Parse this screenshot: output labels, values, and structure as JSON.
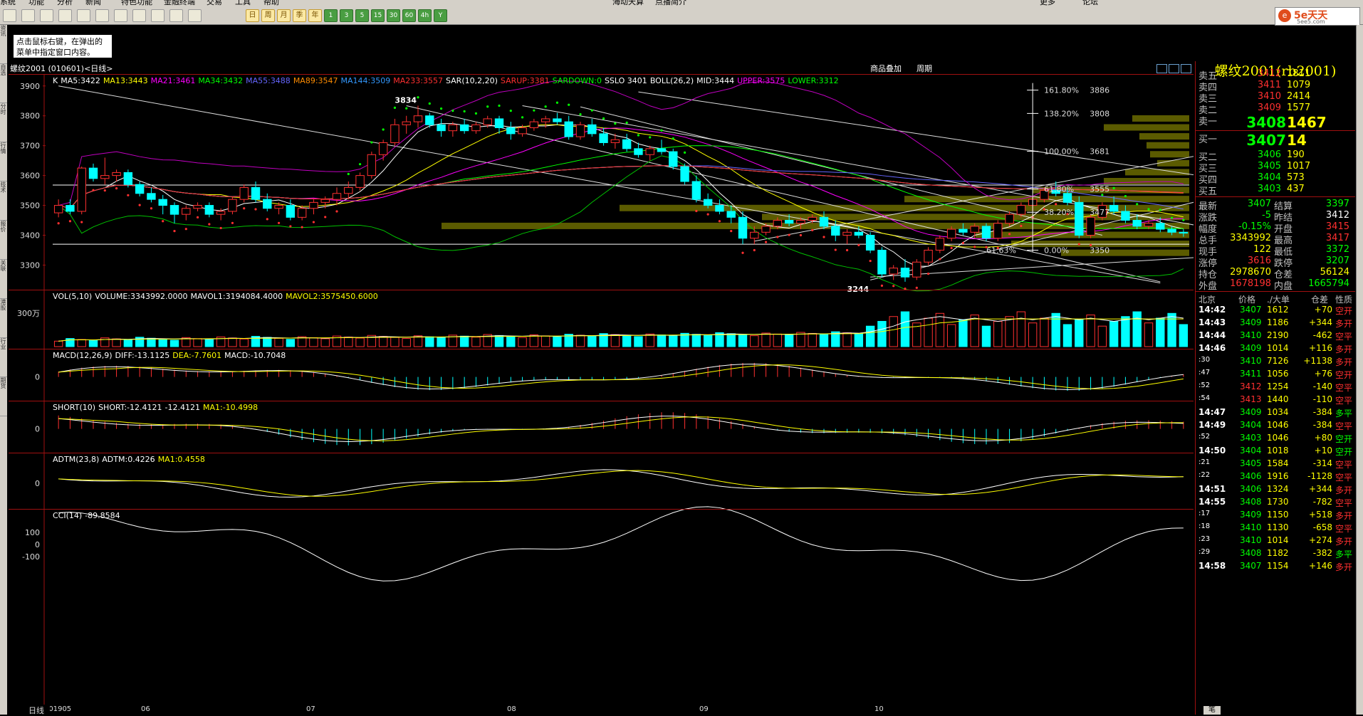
{
  "menu": [
    "系统",
    "功能",
    "分析",
    "新闻",
    "特色功能",
    "金融终端",
    "交易",
    "工具",
    "帮助",
    "海动天算",
    "点播简介",
    "更多",
    "论坛"
  ],
  "toolbar": {
    "periods": [
      "日",
      "周",
      "月",
      "季",
      "年",
      "1",
      "3",
      "5",
      "15",
      "30",
      "60",
      "4h",
      "Y"
    ]
  },
  "logo": {
    "text": "5e天天",
    "sub": "5ee5.com"
  },
  "tooltip": {
    "line1": "点击鼠标右键，在弹出的",
    "line2": "菜单中指定窗口内容。"
  },
  "chart_header": {
    "title": "螺纹2001 (010601)<日线>",
    "link1": "商品叠加",
    "link2": "周期"
  },
  "sidebar_tabs": [
    "资讯",
    "自选",
    "分时",
    "行情",
    "技术",
    "报价",
    "关联",
    "港股",
    "行业",
    "期货"
  ],
  "chart_data": [
    {
      "name": "main",
      "type": "candlestick",
      "labels": [
        {
          "t": "K",
          "c": "#ffffff"
        },
        {
          "t": "MA5:3422",
          "c": "#ffffff"
        },
        {
          "t": "MA13:3443",
          "c": "#ffff00"
        },
        {
          "t": "MA21:3461",
          "c": "#ff00ff"
        },
        {
          "t": "MA34:3432",
          "c": "#00ff00"
        },
        {
          "t": "MA55:3488",
          "c": "#6666ff"
        },
        {
          "t": "MA89:3547",
          "c": "#ff8c00"
        },
        {
          "t": "MA144:3509",
          "c": "#3399ff"
        },
        {
          "t": "MA233:3557",
          "c": "#ff3030"
        },
        {
          "t": "SAR(10,2,20)",
          "c": "#ffffff"
        },
        {
          "t": "SARUP:3381",
          "c": "#ff3030"
        },
        {
          "t": "SARDOWN:0",
          "c": "#00ff00"
        },
        {
          "t": "SSLO 3401",
          "c": "#ffffff"
        },
        {
          "t": "BOLL(26,2)",
          "c": "#ffffff"
        },
        {
          "t": "MID:3444",
          "c": "#ffffff"
        },
        {
          "t": "UPPER:3575",
          "c": "#ff00ff"
        },
        {
          "t": "LOWER:3312",
          "c": "#00ff00"
        }
      ],
      "yticks": [
        3900,
        3800,
        3700,
        3600,
        3500,
        3400,
        3300
      ],
      "ylim": [
        3220,
        3940
      ],
      "fib": [
        {
          "pct": "161.80%",
          "val": "3886",
          "price": 3886
        },
        {
          "pct": "138.20%",
          "val": "3808",
          "price": 3808
        },
        {
          "pct": "100.00%",
          "val": "3681",
          "price": 3681
        },
        {
          "pct": "61.80%",
          "val": "3555",
          "price": 3555
        },
        {
          "pct": "38.20%",
          "val": "3477",
          "price": 3477
        },
        {
          "pct": "0.00%",
          "val": "3350",
          "price": 3350
        }
      ],
      "fib_extra": "61.63%",
      "annotations": [
        {
          "text": "3834",
          "price": 3834
        },
        {
          "text": "3244",
          "price": 3244
        }
      ],
      "candles": [
        [
          3475,
          3520,
          3460,
          3500
        ],
        [
          3500,
          3520,
          3470,
          3480
        ],
        [
          3480,
          3630,
          3470,
          3625
        ],
        [
          3625,
          3640,
          3580,
          3590
        ],
        [
          3590,
          3660,
          3570,
          3600
        ],
        [
          3600,
          3620,
          3580,
          3610
        ],
        [
          3610,
          3620,
          3560,
          3570
        ],
        [
          3570,
          3580,
          3530,
          3540
        ],
        [
          3540,
          3560,
          3510,
          3520
        ],
        [
          3520,
          3535,
          3470,
          3500
        ],
        [
          3500,
          3510,
          3440,
          3470
        ],
        [
          3470,
          3500,
          3450,
          3490
        ],
        [
          3490,
          3510,
          3480,
          3500
        ],
        [
          3500,
          3510,
          3460,
          3470
        ],
        [
          3470,
          3490,
          3450,
          3480
        ],
        [
          3480,
          3530,
          3470,
          3520
        ],
        [
          3520,
          3570,
          3510,
          3560
        ],
        [
          3560,
          3580,
          3510,
          3520
        ],
        [
          3520,
          3540,
          3480,
          3490
        ],
        [
          3490,
          3510,
          3470,
          3500
        ],
        [
          3500,
          3520,
          3450,
          3460
        ],
        [
          3460,
          3500,
          3450,
          3490
        ],
        [
          3490,
          3520,
          3470,
          3510
        ],
        [
          3510,
          3530,
          3490,
          3520
        ],
        [
          3520,
          3560,
          3500,
          3540
        ],
        [
          3540,
          3580,
          3520,
          3560
        ],
        [
          3560,
          3610,
          3550,
          3600
        ],
        [
          3600,
          3680,
          3590,
          3670
        ],
        [
          3670,
          3720,
          3650,
          3710
        ],
        [
          3710,
          3790,
          3700,
          3770
        ],
        [
          3770,
          3800,
          3740,
          3780
        ],
        [
          3780,
          3834,
          3760,
          3800
        ],
        [
          3800,
          3810,
          3760,
          3770
        ],
        [
          3770,
          3790,
          3730,
          3750
        ],
        [
          3750,
          3780,
          3730,
          3770
        ],
        [
          3770,
          3790,
          3740,
          3750
        ],
        [
          3750,
          3780,
          3740,
          3770
        ],
        [
          3770,
          3800,
          3760,
          3790
        ],
        [
          3790,
          3800,
          3740,
          3760
        ],
        [
          3760,
          3780,
          3720,
          3740
        ],
        [
          3740,
          3770,
          3730,
          3760
        ],
        [
          3760,
          3790,
          3750,
          3780
        ],
        [
          3780,
          3800,
          3760,
          3790
        ],
        [
          3790,
          3810,
          3770,
          3780
        ],
        [
          3780,
          3800,
          3720,
          3730
        ],
        [
          3730,
          3780,
          3720,
          3770
        ],
        [
          3770,
          3790,
          3730,
          3740
        ],
        [
          3740,
          3760,
          3700,
          3710
        ],
        [
          3710,
          3740,
          3690,
          3720
        ],
        [
          3720,
          3740,
          3680,
          3690
        ],
        [
          3690,
          3710,
          3660,
          3670
        ],
        [
          3670,
          3700,
          3650,
          3690
        ],
        [
          3690,
          3720,
          3670,
          3680
        ],
        [
          3680,
          3690,
          3620,
          3630
        ],
        [
          3630,
          3640,
          3570,
          3580
        ],
        [
          3580,
          3600,
          3510,
          3520
        ],
        [
          3520,
          3540,
          3490,
          3500
        ],
        [
          3500,
          3520,
          3470,
          3480
        ],
        [
          3480,
          3500,
          3440,
          3460
        ],
        [
          3460,
          3480,
          3370,
          3390
        ],
        [
          3390,
          3430,
          3370,
          3410
        ],
        [
          3410,
          3440,
          3400,
          3430
        ],
        [
          3430,
          3460,
          3420,
          3450
        ],
        [
          3450,
          3470,
          3430,
          3440
        ],
        [
          3440,
          3460,
          3420,
          3450
        ],
        [
          3450,
          3470,
          3440,
          3460
        ],
        [
          3460,
          3480,
          3420,
          3430
        ],
        [
          3430,
          3450,
          3380,
          3400
        ],
        [
          3400,
          3420,
          3370,
          3410
        ],
        [
          3410,
          3430,
          3390,
          3400
        ],
        [
          3400,
          3410,
          3340,
          3350
        ],
        [
          3350,
          3360,
          3260,
          3270
        ],
        [
          3270,
          3300,
          3250,
          3290
        ],
        [
          3290,
          3320,
          3244,
          3260
        ],
        [
          3260,
          3320,
          3250,
          3310
        ],
        [
          3310,
          3360,
          3300,
          3350
        ],
        [
          3350,
          3400,
          3340,
          3390
        ],
        [
          3390,
          3430,
          3380,
          3420
        ],
        [
          3420,
          3440,
          3400,
          3410
        ],
        [
          3410,
          3440,
          3390,
          3430
        ],
        [
          3430,
          3440,
          3380,
          3390
        ],
        [
          3390,
          3450,
          3380,
          3440
        ],
        [
          3440,
          3480,
          3430,
          3470
        ],
        [
          3470,
          3510,
          3460,
          3500
        ],
        [
          3500,
          3530,
          3480,
          3520
        ],
        [
          3520,
          3560,
          3510,
          3550
        ],
        [
          3550,
          3580,
          3530,
          3540
        ],
        [
          3540,
          3560,
          3500,
          3510
        ],
        [
          3510,
          3530,
          3390,
          3400
        ],
        [
          3400,
          3470,
          3390,
          3460
        ],
        [
          3460,
          3510,
          3450,
          3500
        ],
        [
          3500,
          3530,
          3470,
          3480
        ],
        [
          3480,
          3500,
          3440,
          3450
        ],
        [
          3450,
          3470,
          3420,
          3430
        ],
        [
          3430,
          3450,
          3420,
          3440
        ],
        [
          3440,
          3460,
          3410,
          3420
        ],
        [
          3420,
          3430,
          3400,
          3410
        ],
        [
          3410,
          3420,
          3395,
          3407
        ]
      ]
    },
    {
      "name": "volume",
      "type": "bar",
      "labels": [
        {
          "t": "VOL(5,10)",
          "c": "#ffffff"
        },
        {
          "t": "VOLUME:3343992.0000",
          "c": "#ffffff"
        },
        {
          "t": "MAVOL1:3194084.4000",
          "c": "#ffffff"
        },
        {
          "t": "MAVOL2:3575450.6000",
          "c": "#ffff00"
        }
      ],
      "ytick": "300万"
    },
    {
      "name": "macd",
      "type": "bar",
      "labels": [
        {
          "t": "MACD(12,26,9)",
          "c": "#ffffff"
        },
        {
          "t": "DIFF:-13.1125",
          "c": "#ffffff"
        },
        {
          "t": "DEA:-7.7601",
          "c": "#ffff00"
        },
        {
          "t": "MACD:-10.7048",
          "c": "#ffffff"
        }
      ],
      "ytick": "0"
    },
    {
      "name": "short",
      "type": "bar",
      "labels": [
        {
          "t": "SHORT(10)",
          "c": "#ffffff"
        },
        {
          "t": "SHORT:-12.4121",
          "c": "#ffffff"
        },
        {
          "t": "-12.4121",
          "c": "#ffffff"
        },
        {
          "t": "MA1:-10.4998",
          "c": "#ffff00"
        }
      ],
      "ytick": "0"
    },
    {
      "name": "adtm",
      "type": "line",
      "labels": [
        {
          "t": "ADTM(23,8)",
          "c": "#ffffff"
        },
        {
          "t": "ADTM:0.4226",
          "c": "#ffffff"
        },
        {
          "t": "MA1:0.4558",
          "c": "#ffff00"
        }
      ],
      "ytick": "0"
    },
    {
      "name": "cci",
      "type": "line",
      "labels": [
        {
          "t": "CCI(14)",
          "c": "#ffffff"
        },
        {
          "t": "-89.8584",
          "c": "#ffffff"
        }
      ],
      "yticks": [
        "100",
        "0",
        "-100"
      ]
    }
  ],
  "xaxis": {
    "daybtn": "日线",
    "labels": [
      "201905",
      "06",
      "07",
      "08",
      "09",
      "10"
    ]
  },
  "right_panel": {
    "title": "螺纹2001(rb2001)",
    "asks": [
      {
        "k": "卖五",
        "p": "3412",
        "v": "1811",
        "pc": "#ff3030"
      },
      {
        "k": "卖四",
        "p": "3411",
        "v": "1079",
        "pc": "#ff3030"
      },
      {
        "k": "卖三",
        "p": "3410",
        "v": "2414",
        "pc": "#ff3030"
      },
      {
        "k": "卖二",
        "p": "3409",
        "v": "1577",
        "pc": "#ff3030"
      }
    ],
    "ask1": {
      "k": "卖一",
      "p": "3408",
      "v": "1467"
    },
    "bid1": {
      "k": "买一",
      "p": "3407",
      "v": "14"
    },
    "bids": [
      {
        "k": "买二",
        "p": "3406",
        "v": "190"
      },
      {
        "k": "买三",
        "p": "3405",
        "v": "1017"
      },
      {
        "k": "买四",
        "p": "3404",
        "v": "573"
      },
      {
        "k": "买五",
        "p": "3403",
        "v": "437"
      }
    ],
    "stats": [
      {
        "k1": "最新",
        "v1": "3407",
        "c1": "#00ff00",
        "k2": "结算",
        "v2": "3397",
        "c2": "#00ff00"
      },
      {
        "k1": "涨跌",
        "v1": "-5",
        "c1": "#00ff00",
        "k2": "昨结",
        "v2": "3412",
        "c2": "#ffffff"
      },
      {
        "k1": "幅度",
        "v1": "-0.15%",
        "c1": "#00ff00",
        "k2": "开盘",
        "v2": "3415",
        "c2": "#ff3030"
      },
      {
        "k1": "总手",
        "v1": "3343992",
        "c1": "#ffff00",
        "k2": "最高",
        "v2": "3417",
        "c2": "#ff3030"
      },
      {
        "k1": "现手",
        "v1": "122",
        "c1": "#ffff00",
        "k2": "最低",
        "v2": "3372",
        "c2": "#00ff00"
      },
      {
        "k1": "涨停",
        "v1": "3616",
        "c1": "#ff3030",
        "k2": "跌停",
        "v2": "3207",
        "c2": "#00ff00"
      },
      {
        "k1": "持仓",
        "v1": "2978670",
        "c1": "#ffff00",
        "k2": "仓差",
        "v2": "56124",
        "c2": "#ffff00"
      },
      {
        "k1": "外盘",
        "v1": "1678198",
        "c1": "#ff3030",
        "k2": "内盘",
        "v2": "1665794",
        "c2": "#00ff00"
      }
    ],
    "trade_header": [
      "北京",
      "价格",
      "./大单",
      "仓差",
      "性质"
    ],
    "trades": [
      {
        "t": "14:42",
        "p": "3407",
        "v": "1612",
        "d": "+70",
        "n": "空开",
        "nc": "#ff3030",
        "bold": true
      },
      {
        "t": "14:43",
        "p": "3409",
        "v": "1186",
        "d": "+344",
        "n": "多开",
        "nc": "#ff3030",
        "bold": true
      },
      {
        "t": "14:44",
        "p": "3410",
        "v": "2190",
        "d": "-462",
        "n": "空平",
        "nc": "#ff3030",
        "bold": true
      },
      {
        "t": "14:46",
        "p": "3409",
        "v": "1014",
        "d": "+116",
        "n": "多开",
        "nc": "#ff3030",
        "bold": true
      },
      {
        "t": ":30",
        "p": "3410",
        "v": "7126",
        "d": "+1138",
        "n": "多开",
        "nc": "#ff3030",
        "bold": false
      },
      {
        "t": ":47",
        "p": "3411",
        "v": "1056",
        "d": "+76",
        "n": "空开",
        "nc": "#ff3030",
        "bold": false
      },
      {
        "t": ":52",
        "p": "3412",
        "v": "1254",
        "d": "-140",
        "n": "空平",
        "nc": "#ff3030",
        "bold": false
      },
      {
        "t": ":54",
        "p": "3413",
        "v": "1440",
        "d": "-110",
        "n": "空平",
        "nc": "#ff3030",
        "bold": false
      },
      {
        "t": "14:47",
        "p": "3409",
        "v": "1034",
        "d": "-384",
        "n": "多平",
        "nc": "#00ff00",
        "bold": true
      },
      {
        "t": "14:49",
        "p": "3404",
        "v": "1046",
        "d": "-384",
        "n": "空平",
        "nc": "#ff3030",
        "bold": true
      },
      {
        "t": ":52",
        "p": "3403",
        "v": "1046",
        "d": "+80",
        "n": "空开",
        "nc": "#00ff00",
        "bold": false
      },
      {
        "t": "14:50",
        "p": "3404",
        "v": "1018",
        "d": "+10",
        "n": "空开",
        "nc": "#00ff00",
        "bold": true
      },
      {
        "t": ":21",
        "p": "3405",
        "v": "1584",
        "d": "-314",
        "n": "空平",
        "nc": "#ff3030",
        "bold": false
      },
      {
        "t": ":22",
        "p": "3406",
        "v": "1916",
        "d": "-1128",
        "n": "空平",
        "nc": "#ff3030",
        "bold": false
      },
      {
        "t": "14:51",
        "p": "3406",
        "v": "1324",
        "d": "+344",
        "n": "多开",
        "nc": "#ff3030",
        "bold": true
      },
      {
        "t": "14:55",
        "p": "3408",
        "v": "1730",
        "d": "-782",
        "n": "空平",
        "nc": "#ff3030",
        "bold": true
      },
      {
        "t": ":17",
        "p": "3409",
        "v": "1150",
        "d": "+518",
        "n": "多开",
        "nc": "#ff3030",
        "bold": false
      },
      {
        "t": ":18",
        "p": "3410",
        "v": "1130",
        "d": "-658",
        "n": "空平",
        "nc": "#ff3030",
        "bold": false
      },
      {
        "t": ":23",
        "p": "3410",
        "v": "1014",
        "d": "+274",
        "n": "多开",
        "nc": "#ff3030",
        "bold": false
      },
      {
        "t": ":29",
        "p": "3408",
        "v": "1182",
        "d": "-382",
        "n": "多平",
        "nc": "#00ff00",
        "bold": false
      },
      {
        "t": "14:58",
        "p": "3407",
        "v": "1154",
        "d": "+146",
        "n": "多开",
        "nc": "#ff3030",
        "bold": true
      }
    ],
    "bottom_tab": "笔"
  }
}
